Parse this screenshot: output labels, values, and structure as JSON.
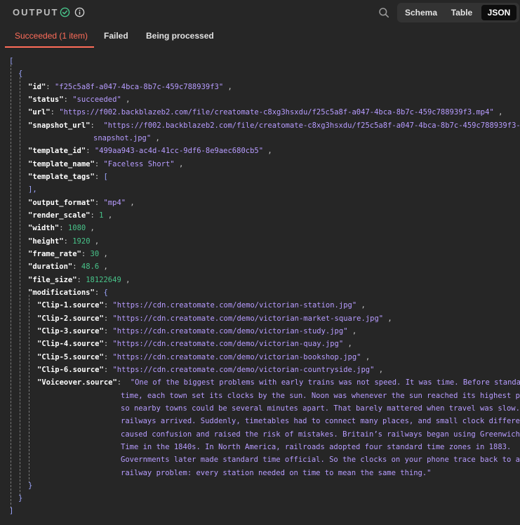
{
  "header": {
    "title": "OUTPUT",
    "views": {
      "schema": "Schema",
      "table": "Table",
      "json": "JSON"
    },
    "active_view": "JSON",
    "colors": {
      "accent": "#ff6d5a",
      "success": "#48c48a"
    }
  },
  "tabs": {
    "succeeded": "Succeeded (1 item)",
    "failed": "Failed",
    "processing": "Being processed"
  },
  "json": {
    "open_array": "[",
    "open_object": "{",
    "close_array": "]",
    "close_object": "}",
    "fields": {
      "id": {
        "key": "\"id\"",
        "value": "\"f25c5a8f-a047-4bca-8b7c-459c788939f3\""
      },
      "status": {
        "key": "\"status\"",
        "value": "\"succeeded\""
      },
      "url": {
        "key": "\"url\"",
        "value": "\"https://f002.backblazeb2.com/file/creatomate-c8xg3hsxdu/f25c5a8f-a047-4bca-8b7c-459c788939f3.mp4\""
      },
      "snapshot_url": {
        "key": "\"snapshot_url\"",
        "value_line1": "\"https://f002.backblazeb2.com/file/creatomate-c8xg3hsxdu/f25c5a8f-a047-4bca-8b7c-459c788939f3-",
        "value_line2": "snapshot.jpg\""
      },
      "template_id": {
        "key": "\"template_id\"",
        "value": "\"499aa943-ac4d-41cc-9df6-8e9aec680cb5\""
      },
      "template_name": {
        "key": "\"template_name\"",
        "value": "\"Faceless Short\""
      },
      "template_tags": {
        "key": "\"template_tags\"",
        "open": "[",
        "close": "],"
      },
      "output_format": {
        "key": "\"output_format\"",
        "value": "\"mp4\""
      },
      "render_scale": {
        "key": "\"render_scale\"",
        "value": "1"
      },
      "width": {
        "key": "\"width\"",
        "value": "1080"
      },
      "height": {
        "key": "\"height\"",
        "value": "1920"
      },
      "frame_rate": {
        "key": "\"frame_rate\"",
        "value": "30"
      },
      "duration": {
        "key": "\"duration\"",
        "value": "48.6"
      },
      "file_size": {
        "key": "\"file_size\"",
        "value": "18122649"
      },
      "modifications": {
        "key": "\"modifications\"",
        "open": "{"
      }
    },
    "modifications": [
      {
        "key": "\"Clip-1.source\"",
        "value": "\"https://cdn.creatomate.com/demo/victorian-station.jpg\""
      },
      {
        "key": "\"Clip-2.source\"",
        "value": "\"https://cdn.creatomate.com/demo/victorian-market-square.jpg\""
      },
      {
        "key": "\"Clip-3.source\"",
        "value": "\"https://cdn.creatomate.com/demo/victorian-study.jpg\""
      },
      {
        "key": "\"Clip-4.source\"",
        "value": "\"https://cdn.creatomate.com/demo/victorian-quay.jpg\""
      },
      {
        "key": "\"Clip-5.source\"",
        "value": "\"https://cdn.creatomate.com/demo/victorian-bookshop.jpg\""
      },
      {
        "key": "\"Clip-6.source\"",
        "value": "\"https://cdn.creatomate.com/demo/victorian-countryside.jpg\""
      }
    ],
    "voiceover": {
      "key": "\"Voiceover.source\"",
      "lines": [
        "\"One of the biggest problems with early trains was not speed. It was time. Before standard",
        "time, each town set its clocks by the sun. Noon was whenever the sun reached its highest point,",
        "so nearby towns could be several minutes apart. That barely mattered when travel was slow. Then",
        "railways arrived. Suddenly, timetables had to connect many places, and small clock differences",
        "caused confusion and raised the risk of mistakes. Britain’s railways began using Greenwich Mean",
        "Time in the 1840s. In North America, railroads adopted four standard time zones in 1883.",
        "Governments later made standard time official. So the clocks on your phone trace back to a",
        "railway problem: every station needed on time to mean the same thing.\""
      ]
    }
  }
}
